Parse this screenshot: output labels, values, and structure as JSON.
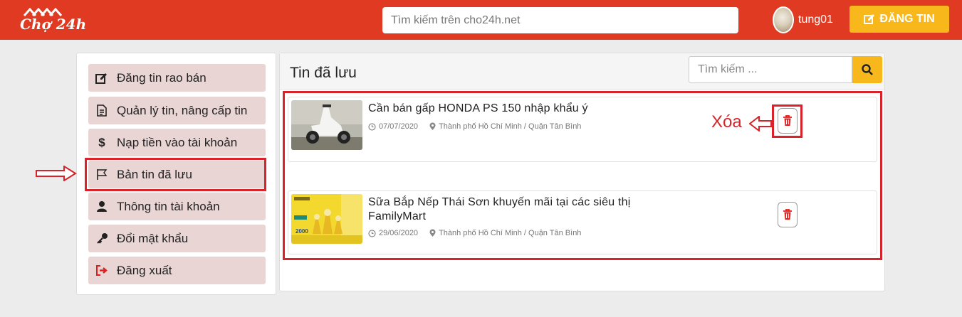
{
  "header": {
    "logo_text": "Chợ 24h",
    "search_placeholder": "Tìm kiếm trên cho24h.net",
    "username": "tung01",
    "post_button": "ĐĂNG TIN"
  },
  "sidebar": {
    "items": [
      {
        "label": "Đăng tin rao bán",
        "icon": "edit-icon"
      },
      {
        "label": "Quản lý tin, nâng cấp tin",
        "icon": "document-icon"
      },
      {
        "label": "Nạp tiền vào tài khoản",
        "icon": "dollar-icon"
      },
      {
        "label": "Bản tin đã lưu",
        "icon": "flag-icon",
        "active": true
      },
      {
        "label": "Thông tin tài khoản",
        "icon": "user-icon"
      },
      {
        "label": "Đổi mật khẩu",
        "icon": "key-icon"
      },
      {
        "label": "Đăng xuất",
        "icon": "sign-out-icon"
      }
    ]
  },
  "main": {
    "title": "Tin đã lưu",
    "search_placeholder": "Tìm kiếm ...",
    "listings": [
      {
        "title": "Cần bán gấp HONDA PS 150 nhập khẩu ý",
        "date": "07/07/2020",
        "location": "Thành phố Hồ Chí Minh / Quận Tân Bình",
        "thumb": "scooter-image"
      },
      {
        "title": "Sữa Bắp Nếp Thái Sơn khuyến mãi tại các siêu thị FamilyMart",
        "date": "29/06/2020",
        "location": "Thành phố Hồ Chí Minh / Quận Tân Bình",
        "thumb": "milk-promo-image",
        "thumb_badge": "2000"
      }
    ]
  },
  "annotation": {
    "delete_label": "Xóa"
  },
  "colors": {
    "header_red": "#e03a22",
    "accent_yellow": "#f8b81c",
    "menu_pink": "#ead5d5",
    "annotation_red": "#d8232a",
    "trash_red": "#e41c1c"
  }
}
